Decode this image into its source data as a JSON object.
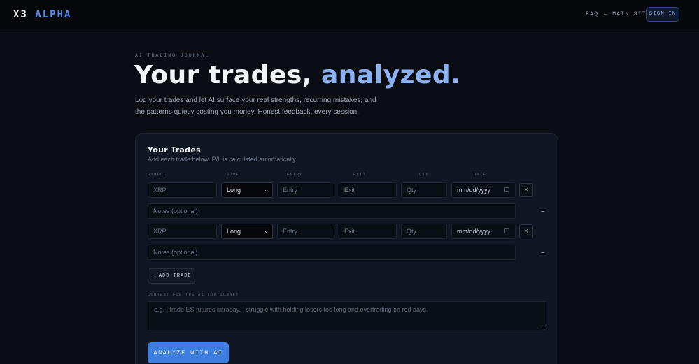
{
  "header": {
    "logo_main": "X3",
    "logo_accent": "ALPHA",
    "nav": {
      "faq": "FAQ",
      "main_site": "← MAIN SITE",
      "sign_in": "SIGN IN"
    }
  },
  "hero": {
    "kicker": "AI TRADING JOURNAL",
    "headline_main": "Your trades,",
    "headline_accent": "analyzed.",
    "subtitle": "Log your trades and let AI surface your real strengths, recurring mistakes, and the patterns quietly costing you money. Honest feedback, every session."
  },
  "card": {
    "title": "Your Trades",
    "description": "Add each trade below. P/L is calculated automatically.",
    "columns": {
      "symbol": "SYMBOL",
      "side": "SIDE",
      "entry": "ENTRY",
      "exit": "EXIT",
      "qty": "QTY",
      "date": "DATE"
    },
    "trades": [
      {
        "symbol_placeholder": "XRP",
        "side": "Long",
        "entry_placeholder": "Entry",
        "exit_placeholder": "Exit",
        "qty_placeholder": "Qty",
        "date": "mm/dd/yyyy",
        "notes_placeholder": "Notes (optional)",
        "remove": "×"
      },
      {
        "symbol_placeholder": "XRP",
        "side": "Long",
        "entry_placeholder": "Entry",
        "exit_placeholder": "Exit",
        "qty_placeholder": "Qty",
        "date": "mm/dd/yyyy",
        "notes_placeholder": "Notes (optional)",
        "remove": "×"
      }
    ],
    "add_trade": "+ ADD TRADE",
    "context_label": "CONTEXT FOR THE AI (OPTIONAL)",
    "context_placeholder": "e.g. I trade ES futures intraday. I struggle with holding losers too long and overtrading on red days.",
    "analyze": "ANALYZE WITH AI"
  },
  "colors": {
    "accent": "#5b8def",
    "headline_accent": "#8cb1f0",
    "button": "#3d7fe0",
    "background": "#0a0d13",
    "card": "#111722"
  },
  "icons": {
    "remove": "close-icon",
    "collapse": "minus-icon",
    "select_caret": "chevron-down-icon",
    "calendar": "calendar-icon"
  }
}
